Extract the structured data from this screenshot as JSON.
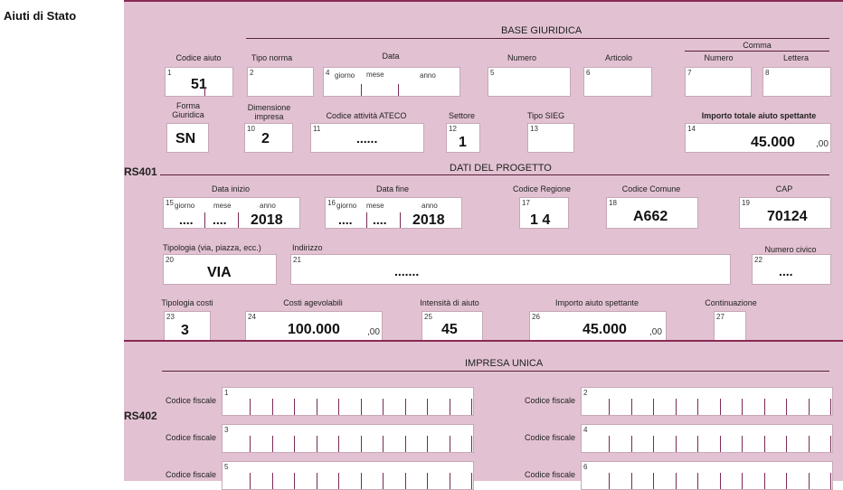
{
  "page_title": "Aiuti di Stato",
  "rs401": {
    "code": "RS401",
    "base_title": "BASE GIURIDICA",
    "codice_aiuto": {
      "label": "Codice aiuto",
      "num": "1",
      "value": "51"
    },
    "tipo_norma": {
      "label": "Tipo norma",
      "num": "2"
    },
    "data": {
      "label": "Data",
      "num": "4",
      "giorno": "giorno",
      "mese": "mese",
      "anno": "anno"
    },
    "numero": {
      "label": "Numero",
      "num": "5"
    },
    "articolo": {
      "label": "Articolo",
      "num": "6"
    },
    "comma": {
      "label": "Comma",
      "numero_label": "Numero",
      "numero_num": "7",
      "lettera_label": "Lettera",
      "lettera_num": "8"
    },
    "forma_giuridica": {
      "label": "Forma Giuridica",
      "value": "SN"
    },
    "dimensione": {
      "label": "Dimensione impresa",
      "num": "10",
      "value": "2"
    },
    "ateco": {
      "label": "Codice attività ATECO",
      "num": "11",
      "value": "......"
    },
    "settore": {
      "label": "Settore",
      "num": "12",
      "value": "1"
    },
    "sieg": {
      "label": "Tipo SIEG",
      "num": "13"
    },
    "importo_totale": {
      "label": "Importo totale aiuto spettante",
      "num": "14",
      "value": "45.000",
      "dec": ",00"
    },
    "progetto_title": "DATI DEL PROGETTO",
    "data_inizio": {
      "label": "Data inizio",
      "num": "15",
      "giorno": "giorno",
      "mese": "mese",
      "anno": "anno",
      "g": "....",
      "m": "....",
      "a": "2018"
    },
    "data_fine": {
      "label": "Data fine",
      "num": "16",
      "giorno": "giorno",
      "mese": "mese",
      "anno": "anno",
      "g": "....",
      "m": "....",
      "a": "2018"
    },
    "codice_regione": {
      "label": "Codice Regione",
      "num": "17",
      "value": "1 4"
    },
    "codice_comune": {
      "label": "Codice Comune",
      "num": "18",
      "value": "A662"
    },
    "cap": {
      "label": "CAP",
      "num": "19",
      "value": "70124"
    },
    "tipologia": {
      "label": "Tipologia (via, piazza, ecc.)",
      "num": "20",
      "value": "VIA"
    },
    "indirizzo": {
      "label": "Indirizzo",
      "num": "21",
      "value": "......."
    },
    "civico": {
      "label": "Numero civico",
      "num": "22",
      "value": "...."
    },
    "tipologia_costi": {
      "label": "Tipologia costi",
      "num": "23",
      "value": "3"
    },
    "costi": {
      "label": "Costi agevolabili",
      "num": "24",
      "value": "100.000",
      "dec": ",00"
    },
    "intensita": {
      "label": "Intensità di aiuto",
      "num": "25",
      "value": "45"
    },
    "importo_spettante": {
      "label": "Importo aiuto spettante",
      "num": "26",
      "value": "45.000",
      "dec": ",00"
    },
    "continuazione": {
      "label": "Continuazione",
      "num": "27"
    }
  },
  "rs402": {
    "code": "RS402",
    "title": "IMPRESA UNICA",
    "cf_label": "Codice fiscale",
    "nums": [
      "1",
      "2",
      "3",
      "4",
      "5",
      "6"
    ]
  }
}
